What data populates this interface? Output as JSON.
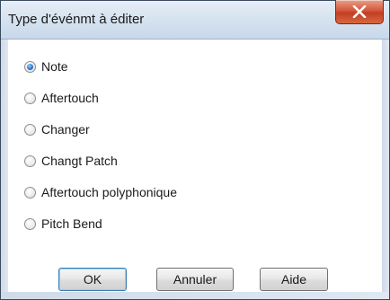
{
  "dialog": {
    "title": "Type d'événmt à éditer"
  },
  "options": [
    {
      "label": "Note",
      "checked": true
    },
    {
      "label": "Aftertouch",
      "checked": false
    },
    {
      "label": "Changer",
      "checked": false
    },
    {
      "label": "Changt Patch",
      "checked": false
    },
    {
      "label": "Aftertouch polyphonique",
      "checked": false
    },
    {
      "label": "Pitch Bend",
      "checked": false
    }
  ],
  "buttons": {
    "ok": "OK",
    "cancel": "Annuler",
    "help": "Aide"
  },
  "colors": {
    "close_button": "#c13f24",
    "titlebar": "#d7e3f0",
    "default_button_border": "#3c7fb1"
  }
}
